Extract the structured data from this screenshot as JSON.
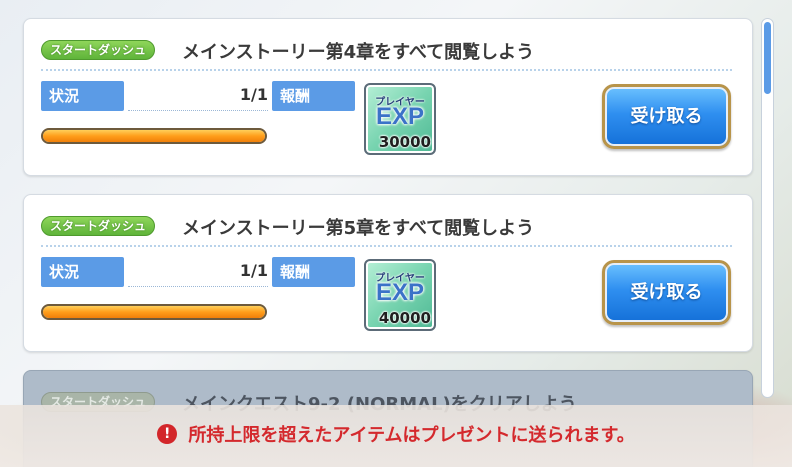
{
  "missions": [
    {
      "tag": "スタートダッシュ",
      "title": "メインストーリー第4章をすべて閲覧しよう",
      "status_label": "状況",
      "status_value": "1/1",
      "progress": 1.0,
      "reward_label": "報酬",
      "reward": {
        "top_text": "プレイヤー",
        "main_text": "EXP",
        "count": "30000",
        "icon": "player-exp-icon"
      },
      "button_label": "受け取る"
    },
    {
      "tag": "スタートダッシュ",
      "title": "メインストーリー第5章をすべて閲覧しよう",
      "status_label": "状況",
      "status_value": "1/1",
      "progress": 1.0,
      "reward_label": "報酬",
      "reward": {
        "top_text": "プレイヤー",
        "main_text": "EXP",
        "count": "40000",
        "icon": "player-exp-icon"
      },
      "button_label": "受け取る"
    },
    {
      "tag": "スタートダッシュ",
      "title": "メインクエスト9-2 (NORMAL)をクリアしよう"
    }
  ],
  "notice": {
    "icon": "exclamation-icon",
    "text": "所持上限を超えたアイテムはプレゼントに送られます。"
  },
  "colors": {
    "accent_blue": "#5b9be6",
    "tag_green": "#5fb43a",
    "progress_orange": "#ff9e1a",
    "warning_red": "#d4292d"
  }
}
